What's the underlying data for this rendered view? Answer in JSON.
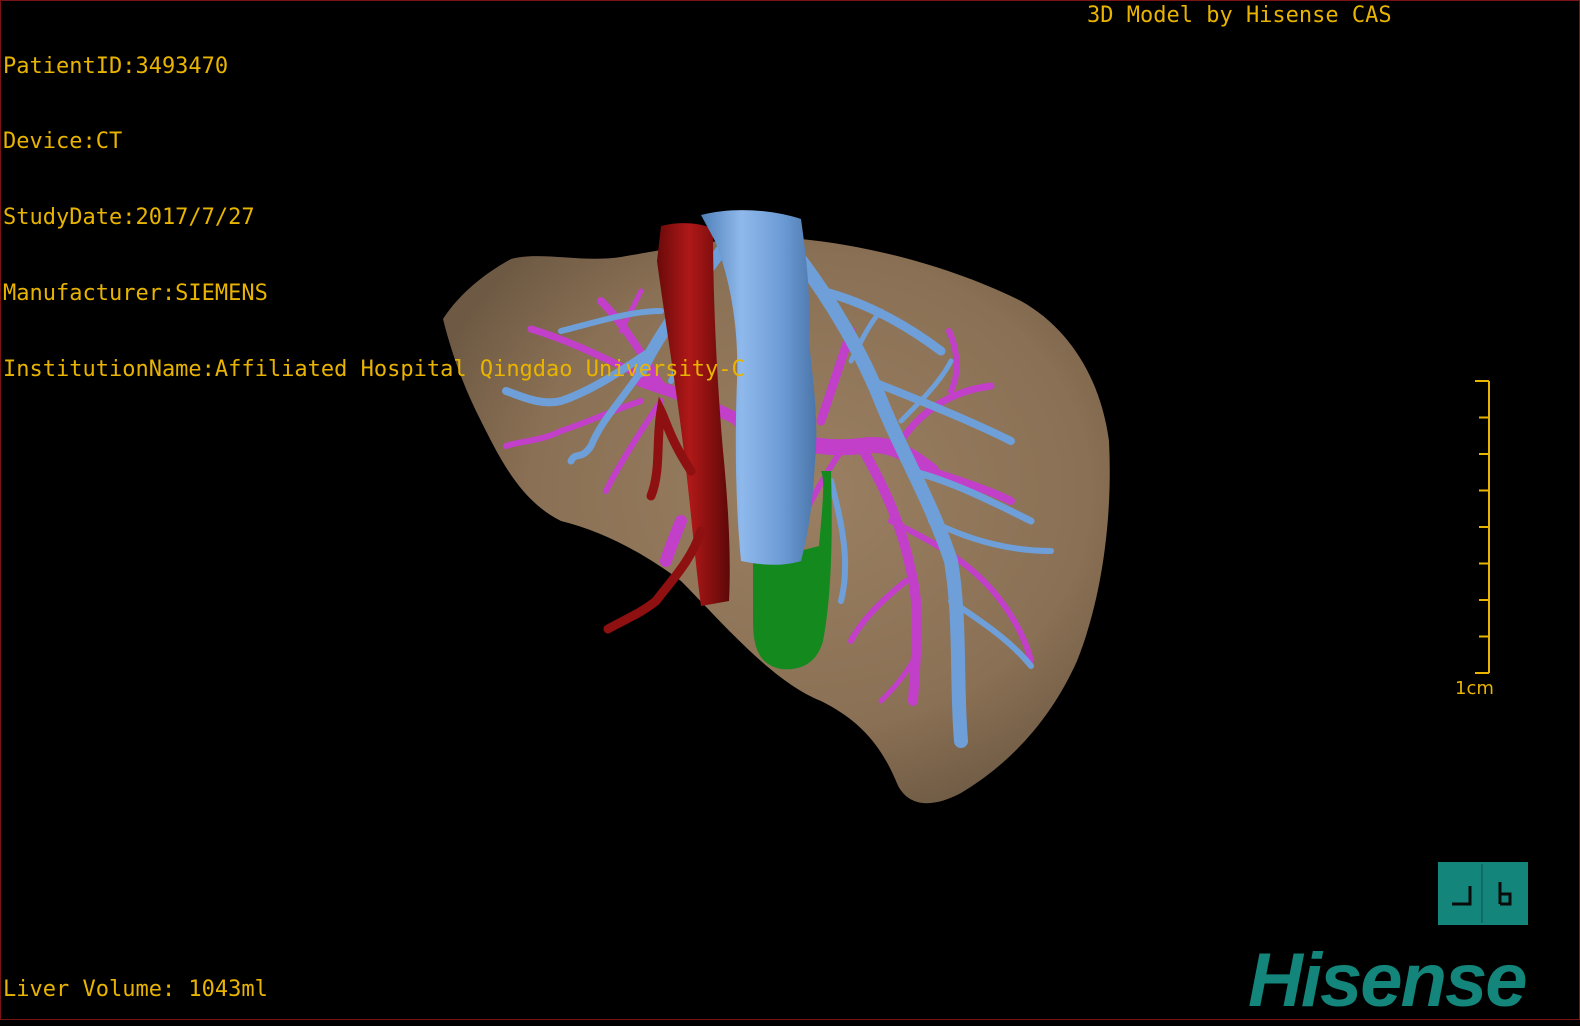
{
  "patient_info": {
    "patient_id": "PatientID:3493470",
    "device": "Device:CT",
    "study_date": "StudyDate:2017/7/27",
    "manufacturer": "Manufacturer:SIEMENS",
    "institution": "InstitutionName:Affiliated Hospital Qingdao University-C"
  },
  "brand_caption": "3D Model by Hisense CAS",
  "liver_volume": "Liver Volume: 1043ml",
  "scale_bar": {
    "label": "1cm",
    "ticks": 9
  },
  "orientation_button": {
    "icon": "anterior-posterior-orientation-icon",
    "color": "#13857b"
  },
  "logo_text": "Hisense",
  "colors": {
    "text": "#e8b400",
    "liver": "#8c7357",
    "hepatic_vein": "#6f9fd8",
    "portal_vein": "#c23fc9",
    "aorta": "#8e1010",
    "stomach": "#148a1e",
    "brand": "#13857b"
  }
}
